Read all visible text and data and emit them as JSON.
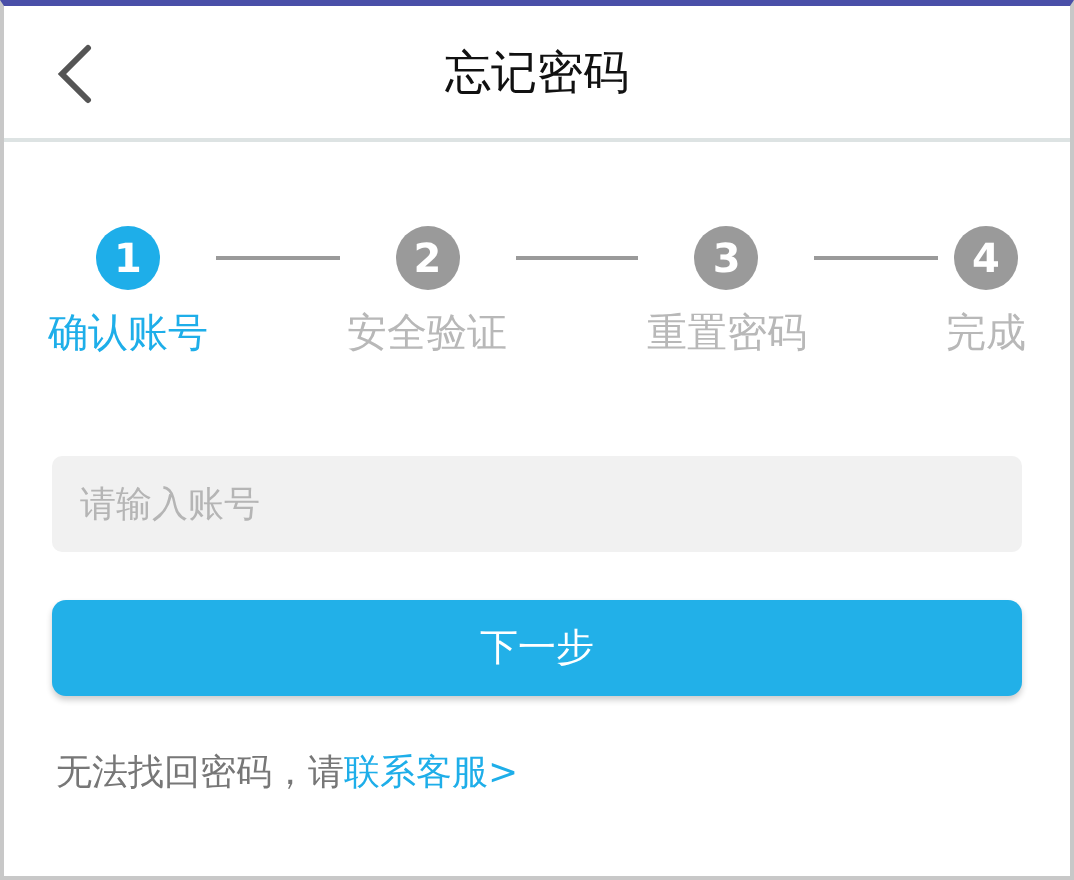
{
  "header": {
    "title": "忘记密码"
  },
  "steps": [
    {
      "number": "1",
      "label": "确认账号",
      "selected": true
    },
    {
      "number": "2",
      "label": "安全验证",
      "selected": false
    },
    {
      "number": "3",
      "label": "重置密码",
      "selected": false
    },
    {
      "number": "4",
      "label": "完成",
      "selected": false
    }
  ],
  "account_field": {
    "placeholder": "请输入账号"
  },
  "next_button": "下一步",
  "help": {
    "text": "无法找回密码，请",
    "link": "联系客服>"
  }
}
